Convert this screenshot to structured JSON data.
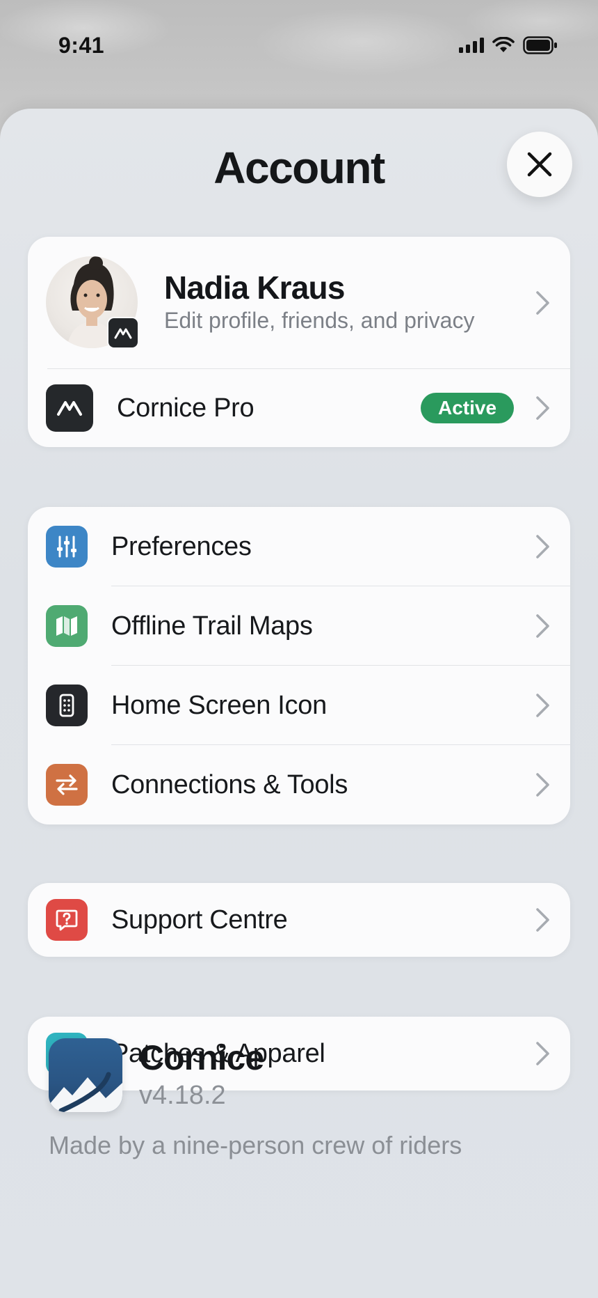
{
  "status_bar": {
    "time": "9:41"
  },
  "sheet": {
    "title": "Account"
  },
  "profile": {
    "name": "Nadia Kraus",
    "subtitle": "Edit profile, friends, and privacy"
  },
  "subscription": {
    "label": "Cornice Pro",
    "status": "Active"
  },
  "settings": {
    "items": [
      {
        "label": "Preferences",
        "icon": "sliders-icon",
        "color": "#3d86c6"
      },
      {
        "label": "Offline Trail Maps",
        "icon": "map-icon",
        "color": "#4faa72"
      },
      {
        "label": "Home Screen Icon",
        "icon": "phone-icon",
        "color": "#25272b"
      },
      {
        "label": "Connections & Tools",
        "icon": "arrows-swap-icon",
        "color": "#cf7143"
      }
    ]
  },
  "support": {
    "label": "Support Centre",
    "icon": "help-bubble-icon",
    "color": "#df4a45"
  },
  "shop": {
    "label": "Patches & Apparel",
    "icon": "shirt-icon",
    "color": "#2fb3bf"
  },
  "about": {
    "app_name": "Cornice",
    "version": "v4.18.2",
    "description": "Made by a nine-person crew of riders"
  }
}
